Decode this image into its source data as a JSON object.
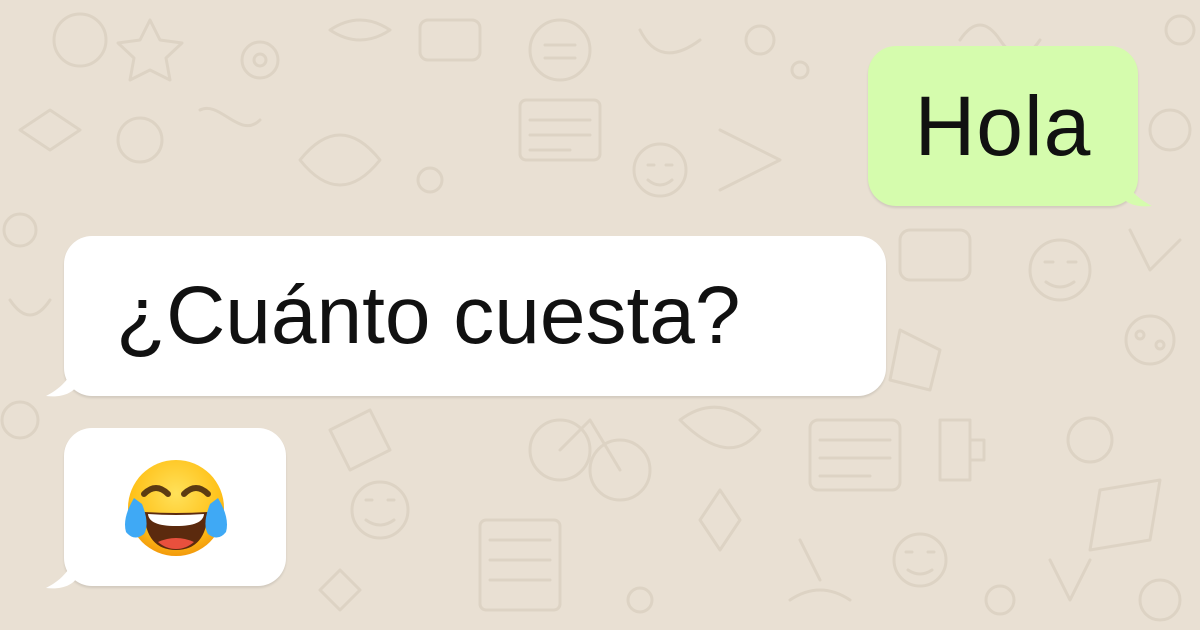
{
  "chat": {
    "outgoing": [
      {
        "text": "Hola"
      }
    ],
    "incoming": [
      {
        "text": "¿Cuánto cuesta?"
      },
      {
        "emoji": "face-with-tears-of-joy"
      }
    ]
  },
  "colors": {
    "background": "#e9e0d3",
    "doodle": "#ddd3c4",
    "outgoing_bubble": "#d5fcad",
    "incoming_bubble": "#ffffff",
    "text": "#111111"
  }
}
